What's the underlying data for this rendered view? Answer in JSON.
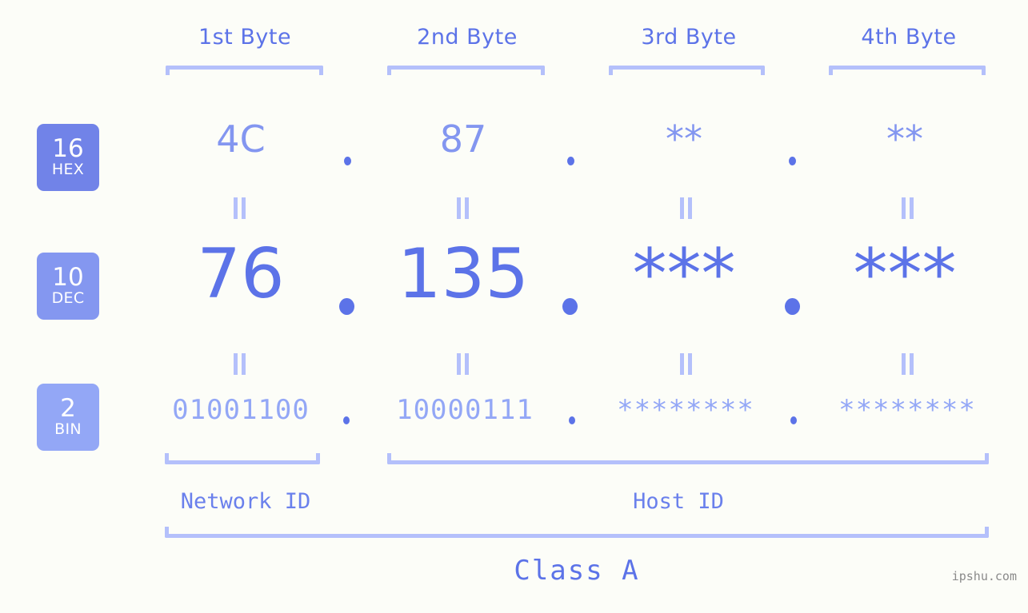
{
  "header": {
    "byte_labels": [
      "1st Byte",
      "2nd Byte",
      "3rd Byte",
      "4th Byte"
    ]
  },
  "radix_badges": [
    {
      "number": "16",
      "name": "HEX",
      "color": "#7183e8"
    },
    {
      "number": "10",
      "name": "DEC",
      "color": "#8497f0"
    },
    {
      "number": "2",
      "name": "BIN",
      "color": "#93a7f6"
    }
  ],
  "rows": {
    "hex": {
      "values": [
        "4C",
        "87",
        "**",
        "**"
      ],
      "separator": "."
    },
    "dec": {
      "values": [
        "76",
        "135",
        "***",
        "***"
      ],
      "separator": "."
    },
    "bin": {
      "values": [
        "01001100",
        "10000111",
        "********",
        "********"
      ],
      "separator": "."
    }
  },
  "equality_marks": "||",
  "footer": {
    "network_id_label": "Network ID",
    "host_id_label": "Host ID",
    "class_label": "Class A",
    "watermark": "ipshu.com"
  },
  "colors": {
    "background": "#fcfdf8",
    "accent_strong": "#5c73e8",
    "accent_mid": "#8396f0",
    "accent_light": "#b4c0fb"
  }
}
